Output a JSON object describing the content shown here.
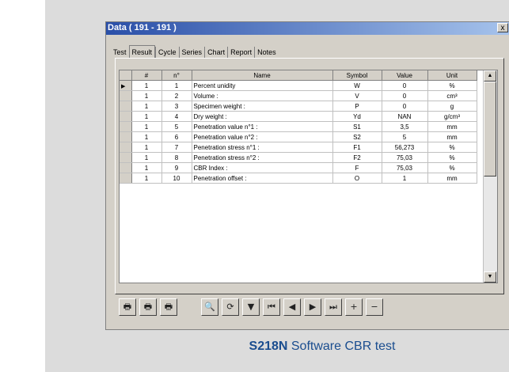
{
  "window": {
    "title": "Data ( 191 - 191 )",
    "close_label": "x"
  },
  "tabs": [
    "Test",
    "Result",
    "Cycle",
    "Series",
    "Chart",
    "Report",
    "Notes"
  ],
  "active_tab": "Result",
  "table": {
    "headers": [
      "#",
      "n°",
      "Name",
      "Symbol",
      "Value",
      "Unit"
    ],
    "rows": [
      [
        "1",
        "1",
        "Percent unidity",
        "W",
        "0",
        "%"
      ],
      [
        "1",
        "2",
        "Volume :",
        "V",
        "0",
        "cm³"
      ],
      [
        "1",
        "3",
        "Specimen weight :",
        "P",
        "0",
        "g"
      ],
      [
        "1",
        "4",
        "Dry weight :",
        "Yd",
        "NAN",
        "g/cm³"
      ],
      [
        "1",
        "5",
        "Penetration value n°1 :",
        "S1",
        "3,5",
        "mm"
      ],
      [
        "1",
        "6",
        "Penetration value n°2 :",
        "S2",
        "5",
        "mm"
      ],
      [
        "1",
        "7",
        "Penetration stress n°1 :",
        "F1",
        "56,273",
        "%"
      ],
      [
        "1",
        "8",
        "Penetration stress n°2 :",
        "F2",
        "75,03",
        "%"
      ],
      [
        "1",
        "9",
        "CBR Index :",
        "F",
        "75,03",
        "%"
      ],
      [
        "1",
        "10",
        "Penetration offset :",
        "O",
        "1",
        "mm"
      ]
    ]
  },
  "toolbar": {
    "buttons": [
      {
        "name": "print-icon",
        "glyph": "🖶"
      },
      {
        "name": "print-preview-icon",
        "glyph": "🖶"
      },
      {
        "name": "print-setup-icon",
        "glyph": "🖶"
      },
      {
        "name": "find-icon",
        "glyph": "🔍"
      },
      {
        "name": "refresh-icon",
        "glyph": "⟳"
      },
      {
        "name": "filter-icon",
        "glyph": "▼"
      },
      {
        "name": "first-record-icon",
        "glyph": "⏮"
      },
      {
        "name": "prev-record-icon",
        "glyph": "◀"
      },
      {
        "name": "next-record-icon",
        "glyph": "▶"
      },
      {
        "name": "last-record-icon",
        "glyph": "⏭"
      },
      {
        "name": "add-record-icon",
        "glyph": "+"
      },
      {
        "name": "delete-record-icon",
        "glyph": "−"
      }
    ]
  },
  "caption": {
    "code": "S218N",
    "text": " Software CBR test"
  }
}
